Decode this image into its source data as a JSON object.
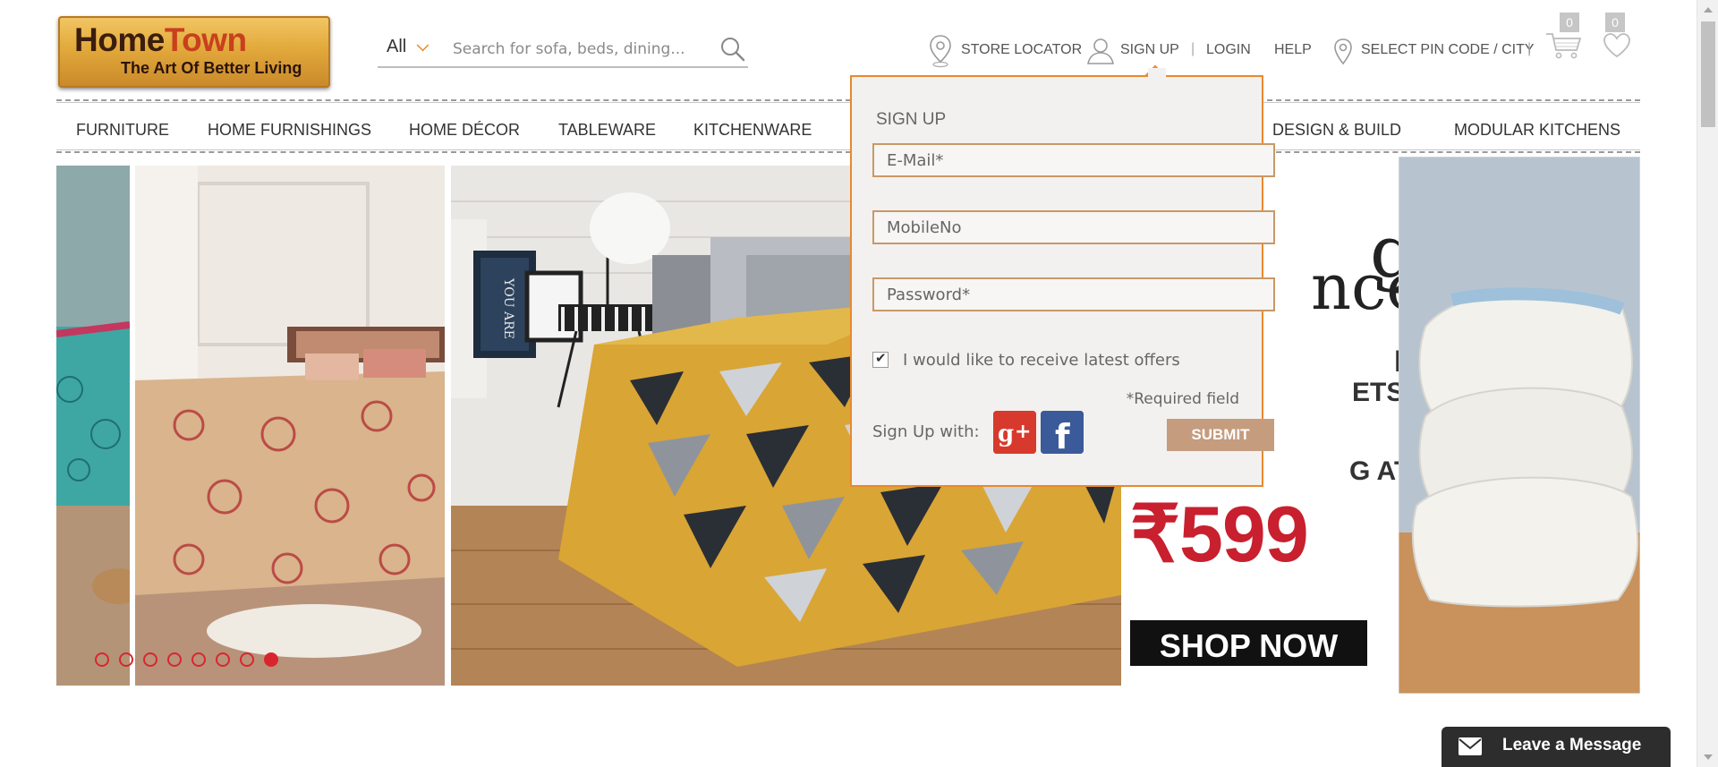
{
  "brand": {
    "logo_main_home": "Home",
    "logo_main_town": "Town",
    "logo_tagline": "The Art Of Better Living"
  },
  "search": {
    "category": "All",
    "placeholder": "Search for sofa, beds, dining..."
  },
  "header_links": {
    "store_locator": "STORE LOCATOR",
    "sign_up": "SIGN UP",
    "separator": "|",
    "login": "LOGIN",
    "help": "HELP",
    "pin_code": "SELECT PIN CODE / CITY",
    "cart_count": "0",
    "wishlist_count": "0"
  },
  "nav": {
    "items": [
      "FURNITURE",
      "HOME FURNISHINGS",
      "HOME DÉCOR",
      "TABLEWARE",
      "KITCHENWARE",
      "DESIGN & BUILD",
      "MODULAR KITCHENS"
    ]
  },
  "banner": {
    "brand_partial": "g",
    "brand_partial2": "nce",
    "line1": "E",
    "line2": "ETS",
    "starting": "G AT",
    "price": "₹599",
    "cta": "SHOP NOW",
    "slide_count": 8,
    "active_slide": 8
  },
  "signup_popup": {
    "title": "SIGN UP",
    "email_placeholder": "E-Mail*",
    "mobile_placeholder": "MobileNo",
    "password_placeholder": "Password*",
    "offers_checked": true,
    "offers_label": "I would like to receive latest offers",
    "required_note": "*Required field",
    "sign_up_with": "Sign Up with:",
    "submit": "SUBMIT"
  },
  "chat": {
    "label": "Leave a Message"
  },
  "colors": {
    "accent_orange": "#e8892d",
    "submit_bg": "#c59c7e",
    "dot_red": "#d9262e",
    "chat_bg": "#2d2d2d",
    "popup_bg": "#f2f1ef",
    "price_red": "#c8202e"
  }
}
